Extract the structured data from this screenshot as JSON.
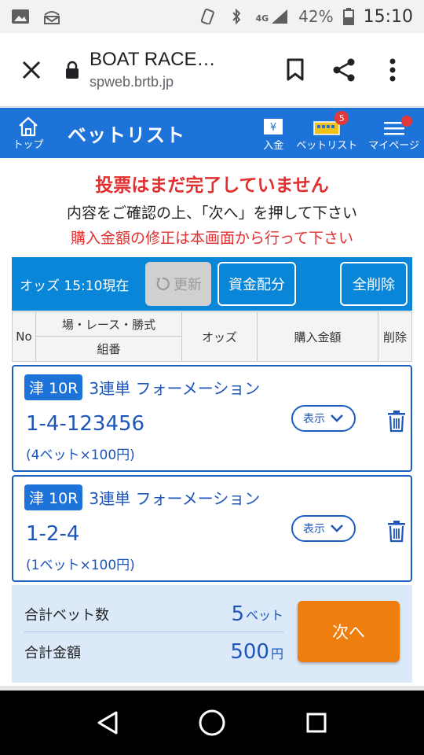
{
  "status_bar": {
    "battery": "42%",
    "time": "15:10",
    "network": "4G"
  },
  "browser": {
    "title": "BOAT RACE…",
    "url": "spweb.brtb.jp"
  },
  "header": {
    "home_label": "トップ",
    "title": "ベットリスト",
    "nav": [
      {
        "label": "入金"
      },
      {
        "label": "ベットリスト",
        "badge": "5"
      },
      {
        "label": "マイページ"
      }
    ]
  },
  "notices": {
    "warning": "投票はまだ完了していません",
    "instruction": "内容をご確認の上、「次へ」を押して下さい",
    "amount_note": "購入金額の修正は本画面から行って下さい"
  },
  "odds_bar": {
    "label": "オッズ 15:10現在",
    "refresh": "更新",
    "allocate": "資金配分",
    "clear_all": "全削除"
  },
  "table_header": {
    "no": "No",
    "race": "場・レース・勝式",
    "combo": "組番",
    "odds": "オッズ",
    "amount": "購入金額",
    "delete": "削除"
  },
  "bets": [
    {
      "venue": "津 10R",
      "type": "3連単 フォーメーション",
      "combo": "1-4-123456",
      "detail": "(4ベット×100円)",
      "show": "表示"
    },
    {
      "venue": "津 10R",
      "type": "3連単 フォーメーション",
      "combo": "1-2-4",
      "detail": "(1ベット×100円)",
      "show": "表示"
    }
  ],
  "summary": {
    "bet_count_label": "合計ベット数",
    "bet_count": "5",
    "bet_count_unit": "ベット",
    "total_label": "合計金額",
    "total": "500",
    "total_unit": "円",
    "next": "次へ"
  },
  "colors": {
    "primary": "#1e73d8",
    "accent": "#ee7f0e",
    "alert": "#e03030"
  }
}
